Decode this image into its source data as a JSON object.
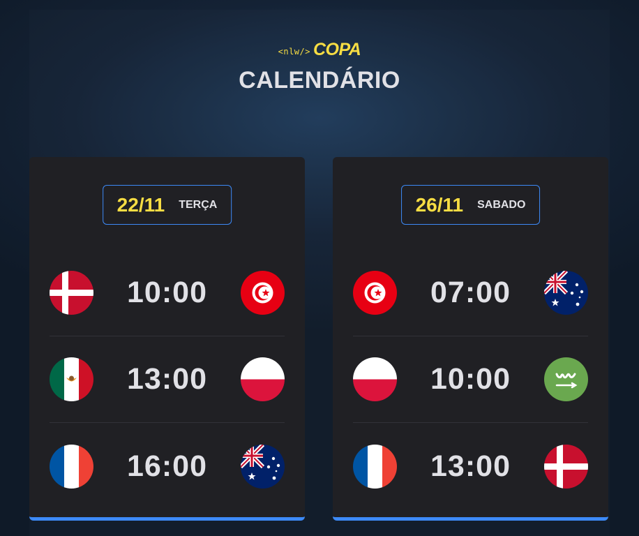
{
  "header": {
    "logo_code": "<nlw/>",
    "logo_name": "COPA",
    "title": "CALENDÁRIO"
  },
  "colors": {
    "accent_yellow": "#f7dd43",
    "accent_blue": "#3d8af7",
    "card_bg": "#202024",
    "text": "#e1e1e6"
  },
  "cards": [
    {
      "date": "22/11",
      "weekday": "TERÇA",
      "matches": [
        {
          "home": "denmark-flag-icon",
          "time": "10:00",
          "away": "tunisia-flag-icon"
        },
        {
          "home": "mexico-flag-icon",
          "time": "13:00",
          "away": "poland-flag-icon"
        },
        {
          "home": "france-flag-icon",
          "time": "16:00",
          "away": "australia-flag-icon"
        }
      ]
    },
    {
      "date": "26/11",
      "weekday": "SABADO",
      "matches": [
        {
          "home": "tunisia-flag-icon",
          "time": "07:00",
          "away": "australia-flag-icon"
        },
        {
          "home": "poland-flag-icon",
          "time": "10:00",
          "away": "saudi-arabia-flag-icon"
        },
        {
          "home": "france-flag-icon",
          "time": "13:00",
          "away": "denmark-flag-icon"
        }
      ]
    }
  ]
}
